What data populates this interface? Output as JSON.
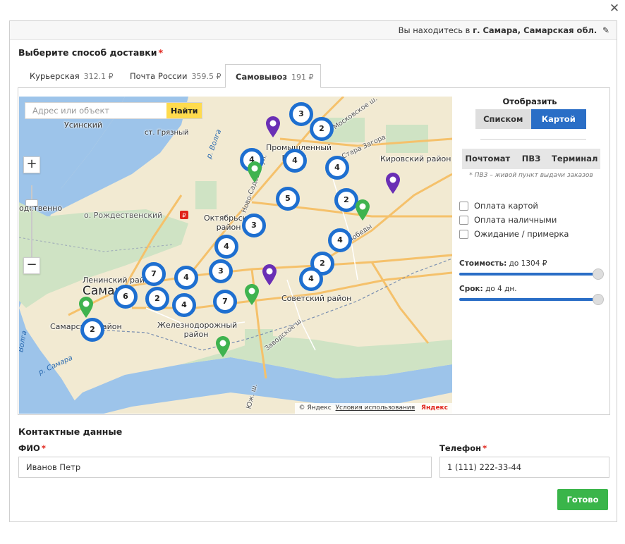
{
  "location_bar": {
    "prefix": "Вы находитесь в",
    "city": "г. Самара, Самарская обл."
  },
  "delivery": {
    "title": "Выберите способ доставки",
    "tabs": [
      {
        "label": "Курьерская",
        "price": "312.1 ₽",
        "active": false
      },
      {
        "label": "Почта России",
        "price": "359.5 ₽",
        "active": false
      },
      {
        "label": "Самовывоз",
        "price": "191 ₽",
        "active": true
      }
    ]
  },
  "map": {
    "search_placeholder": "Адрес или объект",
    "search_button": "Найти",
    "zoom_in": "+",
    "zoom_out": "−",
    "labels": [
      "Усинский",
      "ст. Грязный",
      "р. Волга",
      "одственно",
      "о. Рождественский",
      "Промышленный район",
      "Кировский район",
      "Октябрьский район",
      "Ленинский район",
      "Самара",
      "Самарский район",
      "Железнодорожный район",
      "Советский район",
      "Ново-Садовая ул.",
      "Московское ш.",
      "Стара Загора",
      "ул. Победы",
      "Заводское ш.",
      "р. Самара",
      "Волга",
      "Юж. ш."
    ],
    "clusters": [
      "3",
      "2",
      "4",
      "4",
      "4",
      "5",
      "2",
      "3",
      "4",
      "4",
      "2",
      "7",
      "4",
      "3",
      "4",
      "6",
      "2",
      "4",
      "7",
      "2"
    ],
    "footer": {
      "copyright": "© Яндекс",
      "terms": "Условия использования",
      "brand": "Яндекс"
    },
    "colors": {
      "cluster": "#1e6fd0",
      "pin_green": "#3fb34f",
      "pin_purple": "#6a2fb5",
      "water": "#9dc4ea"
    }
  },
  "side": {
    "show_title": "Отобразить",
    "view_toggle": [
      {
        "label": "Списком",
        "active": false
      },
      {
        "label": "Картой",
        "active": true
      }
    ],
    "types": [
      "Почтомат",
      "ПВЗ",
      "Терминал"
    ],
    "note": "* ПВЗ – живой пункт выдачи заказов",
    "checkboxes": [
      "Оплата картой",
      "Оплата наличными",
      "Ожидание / примерка"
    ],
    "cost": {
      "label": "Стоимость:",
      "value": "до 1304 ₽",
      "fraction": 1.0
    },
    "term": {
      "label": "Срок:",
      "value": "до 4 дн.",
      "fraction": 1.0
    }
  },
  "contacts": {
    "title": "Контактные данные",
    "name_label": "ФИО",
    "name_value": "Иванов Петр",
    "phone_label": "Телефон",
    "phone_value": "1 (111) 222-33-44",
    "submit": "Готово"
  }
}
